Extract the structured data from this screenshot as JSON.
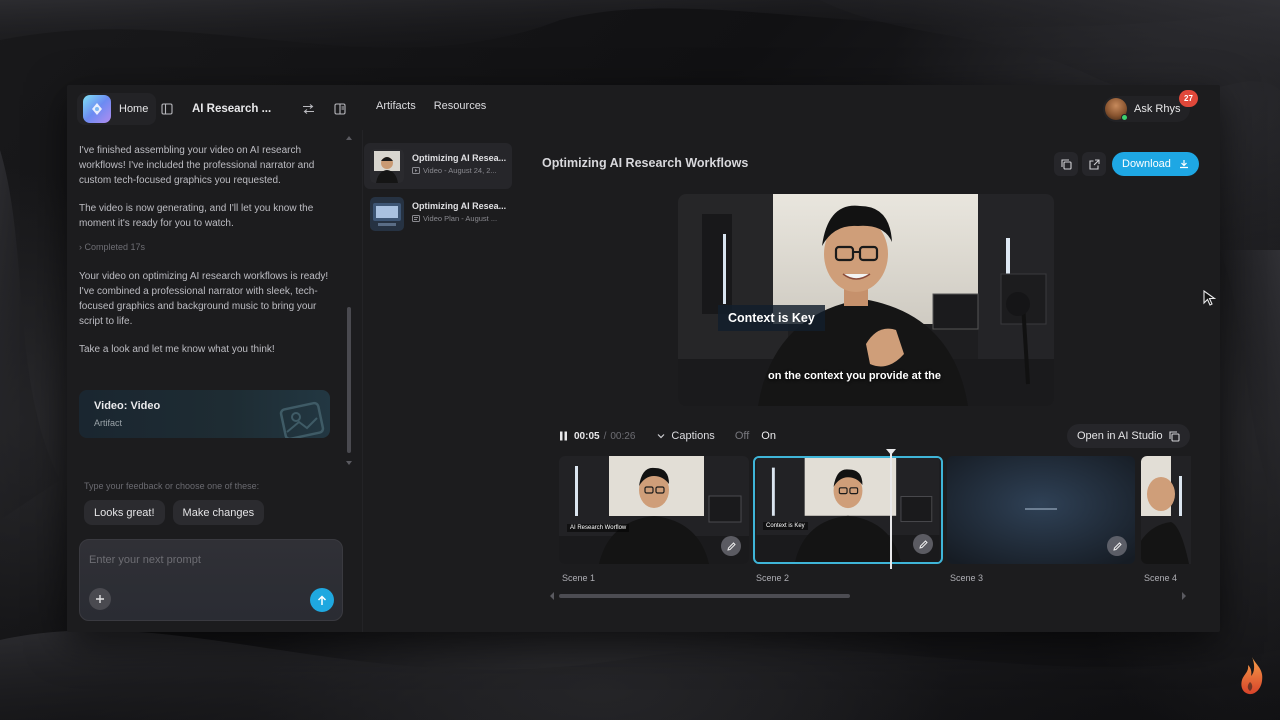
{
  "header": {
    "home_label": "Home",
    "project_title": "AI Research ...",
    "tabs": [
      "Artifacts",
      "Resources"
    ],
    "user_label": "Ask Rhys",
    "notification_count": "27"
  },
  "chat": {
    "messages": [
      "I've finished assembling your video on AI research workflows! I've included the professional narrator and custom tech-focused graphics you requested.",
      "The video is now generating, and I'll let you know the moment it's ready for you to watch."
    ],
    "completed_label": "Completed 17s",
    "messages_after": [
      "Your video on optimizing AI research workflows is ready! I've combined a professional narrator with sleek, tech-focused graphics and background music to bring your script to life.",
      "Take a look and let me know what you think!"
    ],
    "artifact_card": {
      "title": "Video: Video",
      "subtitle": "Artifact"
    },
    "feedback_hint": "Type your feedback or choose one of these:",
    "chips": [
      "Looks great!",
      "Make changes"
    ],
    "prompt_placeholder": "Enter your next prompt"
  },
  "artifacts": [
    {
      "name": "Optimizing AI Resea...",
      "meta": "Video - August 24, 2...",
      "icon": "video-icon"
    },
    {
      "name": "Optimizing AI Resea...",
      "meta": "Video Plan - August ...",
      "icon": "plan-icon"
    }
  ],
  "main": {
    "video_title": "Optimizing AI Research Workflows",
    "download_label": "Download",
    "caption_box": "Context is Key",
    "caption_line": "on the context you provide at the",
    "player": {
      "current_time": "00:05",
      "separator": "/",
      "total_time": "00:26",
      "captions_label": "Captions",
      "toggle_off": "Off",
      "toggle_on": "On",
      "open_studio_label": "Open in AI Studio"
    },
    "scenes": [
      {
        "label": "Scene 1",
        "tag": "AI Research Worflow"
      },
      {
        "label": "Scene 2",
        "tag": "Context is Key"
      },
      {
        "label": "Scene 3",
        "tag": ""
      },
      {
        "label": "Scene 4",
        "tag": ""
      }
    ]
  },
  "colors": {
    "accent": "#1ea7e4",
    "active_scene_border": "#3fb5d8",
    "notification": "#e0483a",
    "panel_bg": "#1c1c1e"
  }
}
